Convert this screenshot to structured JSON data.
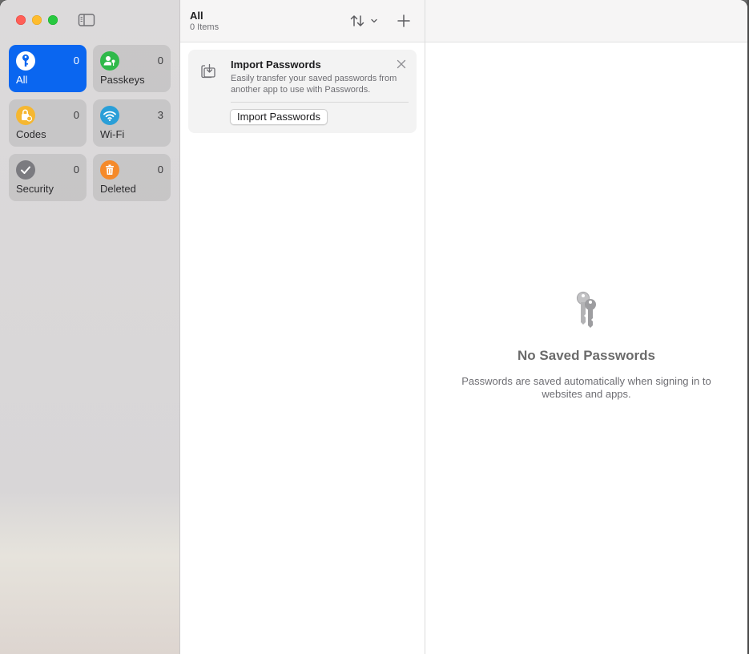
{
  "sidebar": {
    "tiles": [
      {
        "label": "All",
        "count": "0",
        "icon": "key-icon",
        "color": "#ffffff",
        "active": true
      },
      {
        "label": "Passkeys",
        "count": "0",
        "icon": "person-key-icon",
        "color": "#30b94a"
      },
      {
        "label": "Codes",
        "count": "0",
        "icon": "lock-clock-icon",
        "color": "#f5b731"
      },
      {
        "label": "Wi-Fi",
        "count": "3",
        "icon": "wifi-icon",
        "color": "#2a9fd8"
      },
      {
        "label": "Security",
        "count": "0",
        "icon": "checkmark-icon",
        "color": "#7b7b80"
      },
      {
        "label": "Deleted",
        "count": "0",
        "icon": "trash-icon",
        "color": "#f58a2a"
      }
    ]
  },
  "list": {
    "title": "All",
    "subtitle": "0 Items",
    "import_card": {
      "title": "Import Passwords",
      "description": "Easily transfer your saved passwords from another app to use with Passwords.",
      "button_label": "Import Passwords"
    }
  },
  "detail": {
    "empty_title": "No Saved Passwords",
    "empty_description": "Passwords are saved automatically when signing in to websites and apps."
  },
  "colors": {
    "accent": "#0a66f0"
  }
}
